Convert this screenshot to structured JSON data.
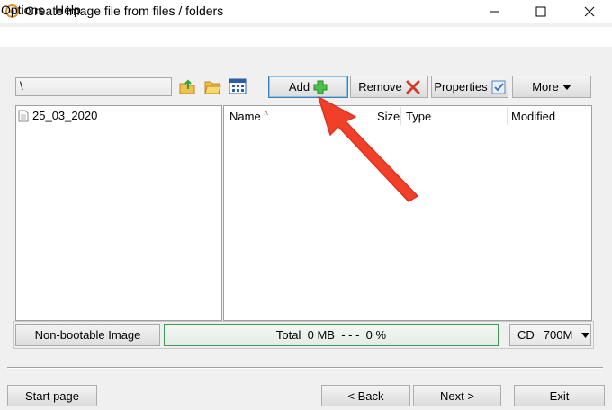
{
  "window": {
    "title": "Create image file from files / folders"
  },
  "menu": {
    "items": [
      "Options",
      "Help"
    ]
  },
  "path": {
    "value": "\\"
  },
  "toolbar": {
    "add_label": "Add",
    "remove_label": "Remove",
    "properties_label": "Properties",
    "more_label": "More"
  },
  "tree": {
    "items": [
      "25_03_2020"
    ]
  },
  "file_list": {
    "columns": [
      "Name",
      "Size",
      "Type",
      "Modified"
    ]
  },
  "status": {
    "boot_label": "Non-bootable Image",
    "total_label": "Total",
    "total_value": "0 MB",
    "total_dashes": "- - -",
    "total_percent": "0 %",
    "media_type": "CD",
    "media_size": "700M"
  },
  "footer": {
    "start_page_label": "Start page",
    "back_label": "< Back",
    "next_label": "Next >",
    "exit_label": "Exit"
  },
  "colors": {
    "annotation_arrow": "#f0402a",
    "progress_border": "#3e9a55",
    "focus_border": "#3c7fb1"
  }
}
